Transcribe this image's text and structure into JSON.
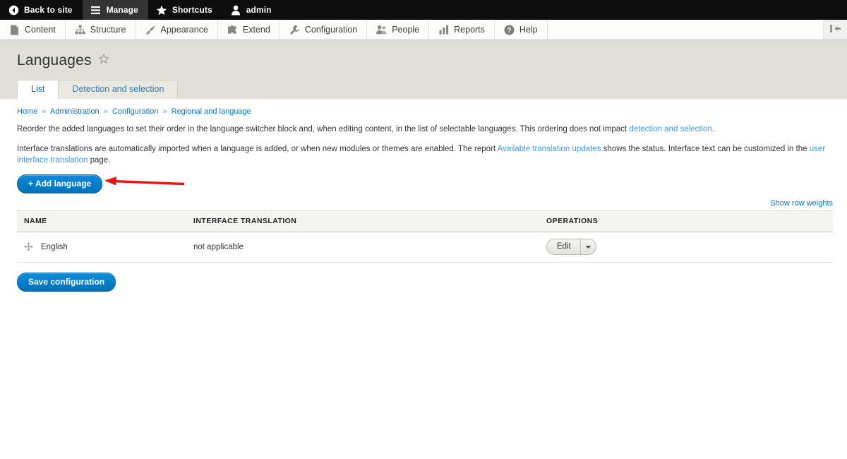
{
  "admin_toolbar": {
    "items": [
      {
        "label": "Back to site",
        "icon": "back-arrow-circle-icon",
        "active": false
      },
      {
        "label": "Manage",
        "icon": "hamburger-icon",
        "active": true
      },
      {
        "label": "Shortcuts",
        "icon": "star-icon",
        "active": false
      },
      {
        "label": "admin",
        "icon": "user-icon",
        "active": false
      }
    ]
  },
  "menu_bar": {
    "items": [
      {
        "label": "Content",
        "icon": "document-icon"
      },
      {
        "label": "Structure",
        "icon": "sitemap-icon"
      },
      {
        "label": "Appearance",
        "icon": "paintbrush-icon"
      },
      {
        "label": "Extend",
        "icon": "puzzle-piece-icon"
      },
      {
        "label": "Configuration",
        "icon": "wrench-icon"
      },
      {
        "label": "People",
        "icon": "people-icon"
      },
      {
        "label": "Reports",
        "icon": "bar-chart-icon"
      },
      {
        "label": "Help",
        "icon": "question-circle-icon"
      }
    ],
    "orientation_toggle_icon": "vertical-orientation-icon"
  },
  "page": {
    "title": "Languages",
    "favorite_icon": "star-outline-icon",
    "tabs": [
      {
        "label": "List",
        "active": true
      },
      {
        "label": "Detection and selection",
        "active": false
      }
    ]
  },
  "breadcrumb": {
    "separator": "»",
    "items": [
      "Home",
      "Administration",
      "Configuration",
      "Regional and language"
    ]
  },
  "descriptions": {
    "paragraph1": {
      "text_before": "Reorder the added languages to set their order in the language switcher block and, when editing content, in the list of selectable languages. This ordering does not impact ",
      "link": "detection and selection",
      "text_after": "."
    },
    "paragraph2": {
      "part1": "Interface translations are automatically imported when a language is added, or when new modules or themes are enabled. The report ",
      "link1": "Available translation updates",
      "part2": " shows the status. Interface text can be customized in the ",
      "link2": "user interface translation",
      "part3": " page."
    }
  },
  "actions": {
    "add_language_label": "+ Add language",
    "save_configuration_label": "Save configuration",
    "show_row_weights_label": "Show row weights"
  },
  "table": {
    "columns": [
      "NAME",
      "INTERFACE TRANSLATION",
      "OPERATIONS"
    ],
    "rows": [
      {
        "name": "English",
        "interface_translation": "not applicable",
        "operation_label": "Edit",
        "drag_icon": "drag-move-icon",
        "toggle_icon": "chevron-down-icon"
      }
    ]
  },
  "annotation": {
    "arrow_color": "#ee1111",
    "arrow_direction": "left",
    "points_at": "add-language-button"
  },
  "colors": {
    "accent_blue": "#0074bd",
    "button_blue": "#0071b8",
    "toolbar_black": "#0d0d0d",
    "header_grey": "#e0e0d8",
    "annotation_red": "#ee1111"
  }
}
